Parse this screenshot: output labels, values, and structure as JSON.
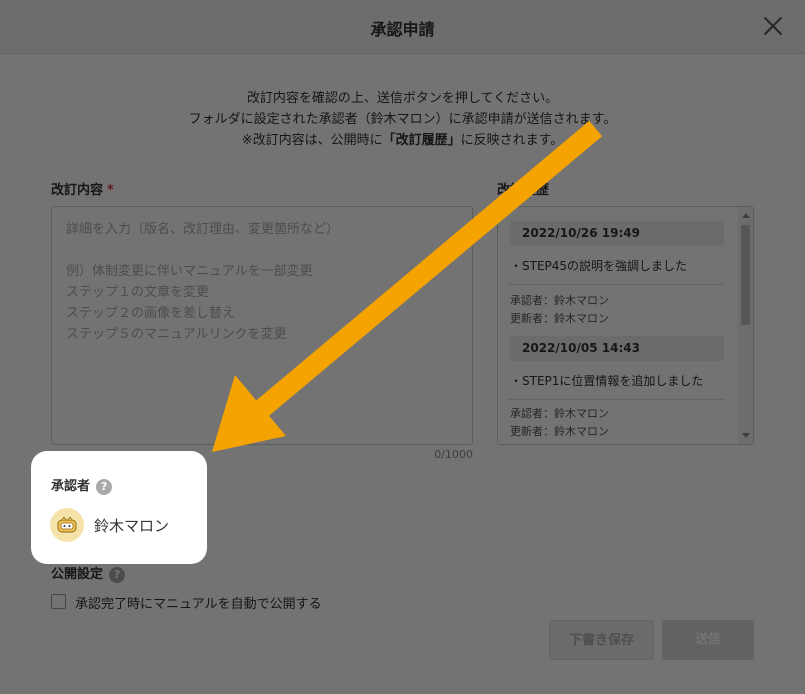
{
  "dialog": {
    "title": "承認申請",
    "intro": {
      "line1": "改訂内容を確認の上、送信ボタンを押してください。",
      "line2": "フォルダに設定された承認者（鈴木マロン）に承認申請が送信されます。",
      "line3_prefix": "※改訂内容は、公開時に",
      "line3_bold": "「改訂履歴」",
      "line3_suffix": "に反映されます。"
    }
  },
  "revision": {
    "label": "改訂内容",
    "required_mark": "*",
    "placeholder": "詳細を入力（版名、改訂理由、変更箇所など）\n\n例）体制変更に伴いマニュアルを一部変更\nステップ１の文章を変更\nステップ２の画像を差し替え\nステップ５のマニュアルリンクを変更",
    "counter": "0/1000"
  },
  "history": {
    "label": "改訂履歴",
    "entries": [
      {
        "date": "2022/10/26 19:49",
        "text": "・STEP45の説明を強調しました",
        "approver": "承認者：鈴木マロン",
        "updater": "更新者：鈴木マロン"
      },
      {
        "date": "2022/10/05 14:43",
        "text": "・STEP1に位置情報を追加しました",
        "approver": "承認者：鈴木マロン",
        "updater": "更新者：鈴木マロン"
      }
    ]
  },
  "approver": {
    "label": "承認者",
    "help": "?",
    "name": "鈴木マロン"
  },
  "publish": {
    "label": "公開設定",
    "help": "?",
    "checkbox_label": "承認完了時にマニュアルを自動で公開する",
    "checked": false
  },
  "buttons": {
    "draft": "下書き保存",
    "submit": "送信"
  },
  "colors": {
    "arrow": "#f5a300",
    "required": "#e0393e"
  }
}
